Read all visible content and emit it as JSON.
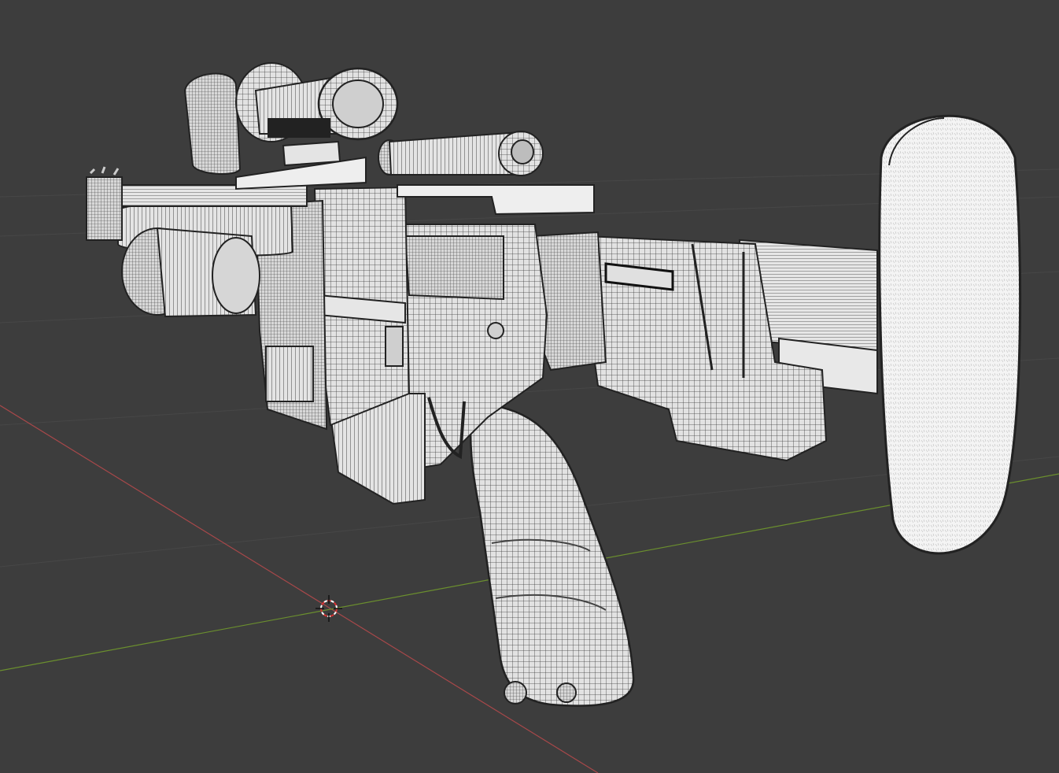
{
  "viewport": {
    "background": "#3d3d3d",
    "grid_color": "#4a4a4a",
    "x_axis_color": "#a8484a",
    "y_axis_color": "#6b8f2e",
    "cursor_colors": [
      "#d73232",
      "#ffffff"
    ]
  },
  "model": {
    "kind": "rifle-wireframe-mesh",
    "mesh_fill": "#dcdcdc",
    "wire_color": "#2a2a2a",
    "highlight": "#f2f2f2"
  }
}
